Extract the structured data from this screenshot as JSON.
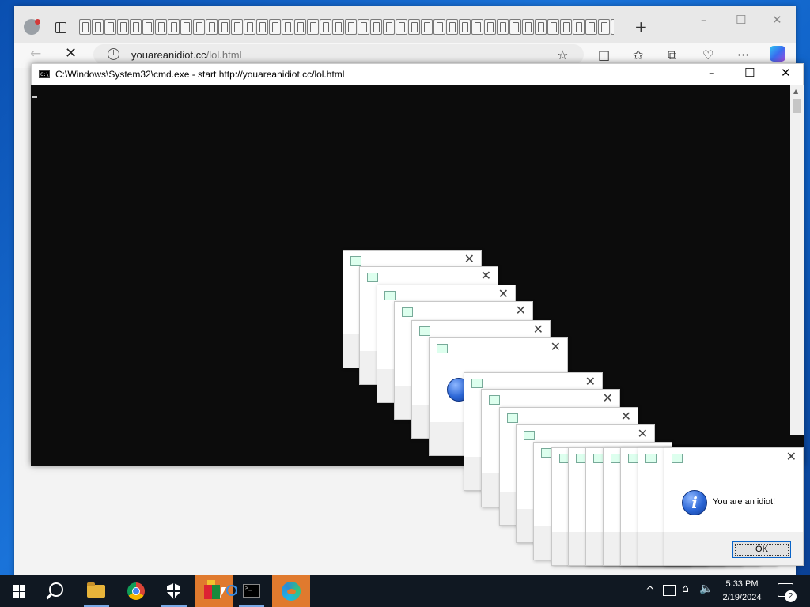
{
  "browser": {
    "url_domain": "youareanidiot.cc",
    "url_path": "/lol.html",
    "tab_count": 43,
    "new_tab_symbol": "+",
    "minimize_symbol": "–",
    "maximize_symbol": "☐",
    "close_symbol": "✕",
    "back_symbol": "←",
    "stop_symbol": "✕",
    "info_symbol": "i",
    "toolbar": {
      "favorite_symbol": "☆",
      "split_symbol": "◫",
      "favorites_symbol": "✩",
      "collections_symbol": "⧉",
      "performance_symbol": "♡",
      "more_symbol": "···"
    }
  },
  "cmd": {
    "title": "C:\\Windows\\System32\\cmd.exe - start  http://youareanidiot.cc/lol.html",
    "icon_text": "C:\\",
    "minimize_symbol": "–",
    "maximize_symbol": "☐",
    "close_symbol": "✕",
    "scroll_up_symbol": "▲"
  },
  "popup": {
    "message": "You are an idiot!",
    "ok_label": "OK",
    "close_symbol": "✕",
    "info_glyph": "i"
  },
  "taskbar": {
    "time": "5:33 PM",
    "date": "2/19/2024",
    "notification_count": "2",
    "terminal_glyph": ">_",
    "tray": {
      "chevron": "^",
      "network_symbol": "⌂",
      "volume_symbol": "🔈"
    }
  },
  "colors": {
    "desktop": "#0a4fb0",
    "taskbar": "#101822",
    "active_task": "#e07a2e",
    "console_bg": "#0c0c0c",
    "ok_border": "#0a64c8"
  }
}
